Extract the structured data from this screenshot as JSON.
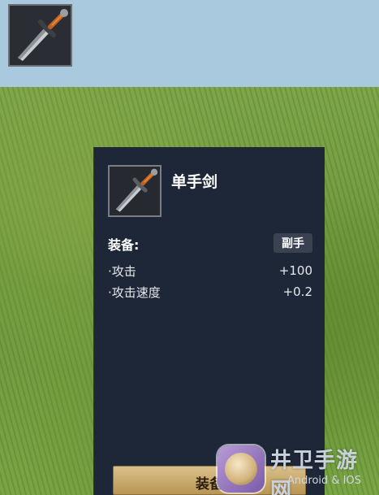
{
  "item": {
    "name": "单手剑",
    "icon": "sword-icon"
  },
  "equip": {
    "label": "装备:",
    "slot": "副手"
  },
  "stats": [
    {
      "label": "·攻击",
      "value": "+100"
    },
    {
      "label": "·攻击速度",
      "value": "+0.2"
    }
  ],
  "action": {
    "equip_button": "装备"
  },
  "watermark": {
    "name": "井卫手游网",
    "sub": "Android & IOS"
  },
  "colors": {
    "sky": "#a9c9df",
    "panel": "#1e2738",
    "button": "#c8a86c"
  }
}
